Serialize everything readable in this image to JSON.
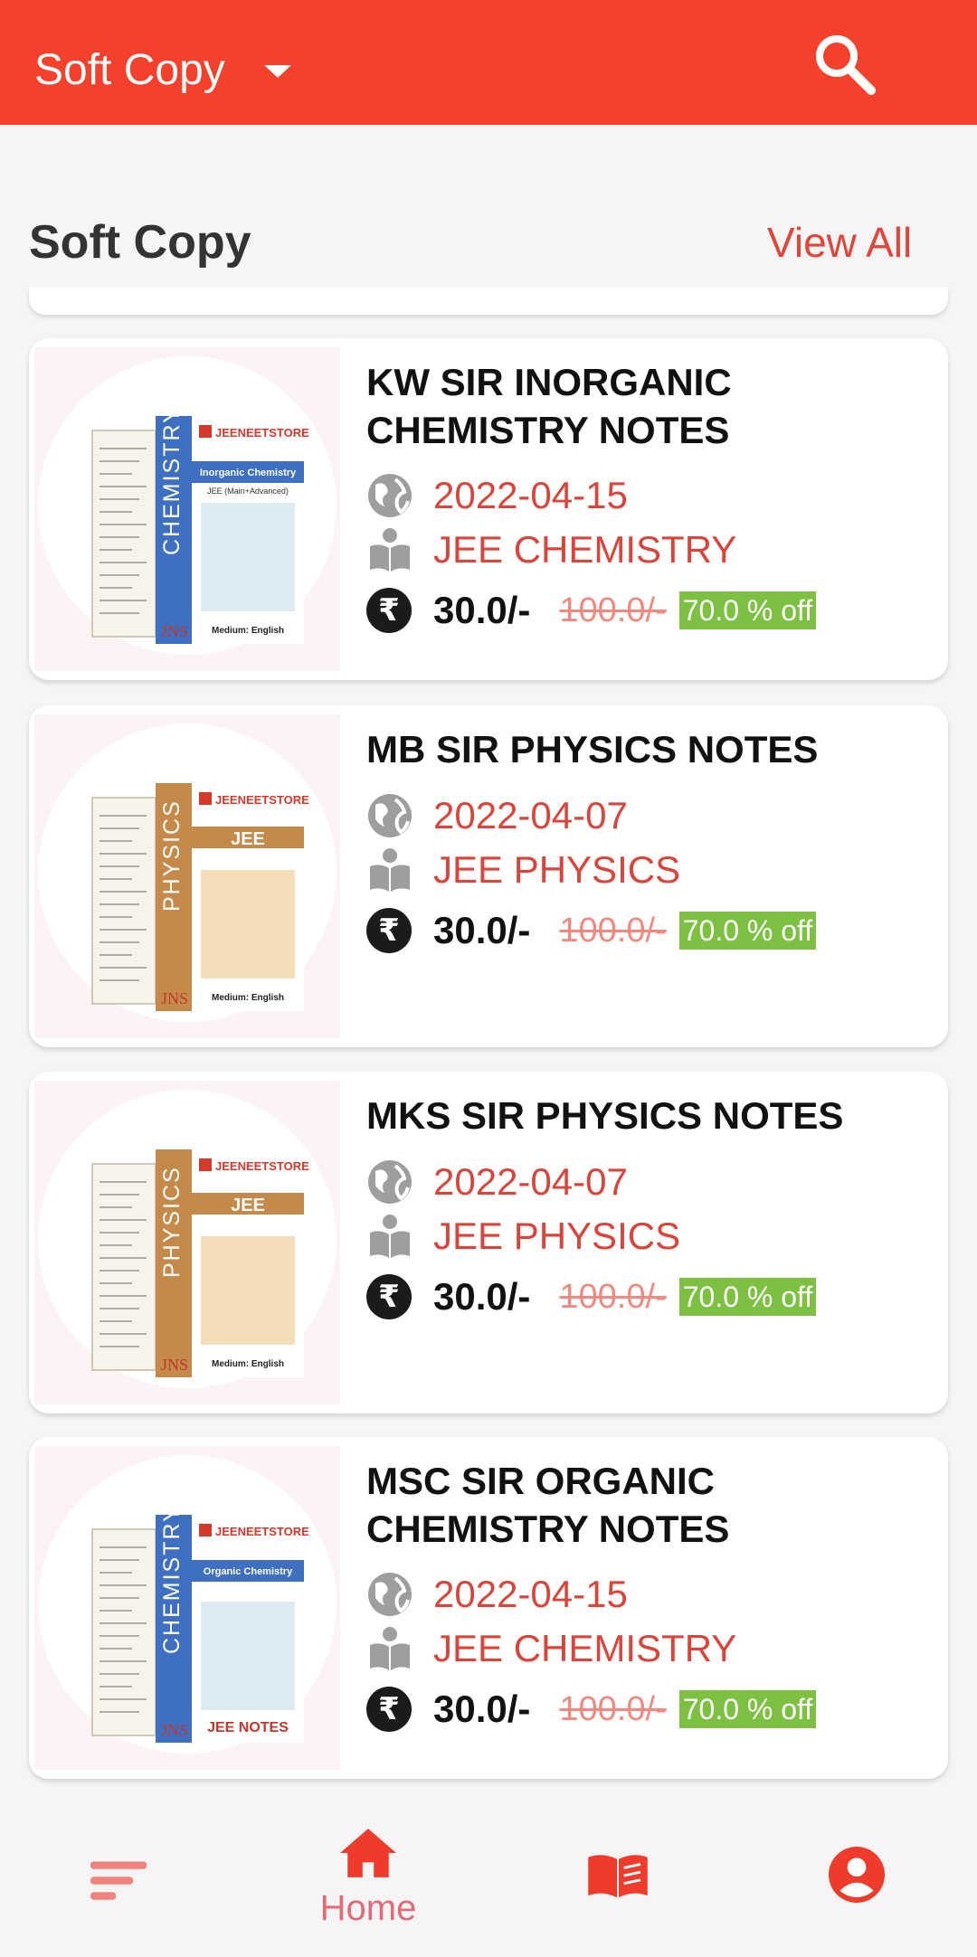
{
  "appbar": {
    "title": "Soft Copy"
  },
  "section": {
    "title": "Soft Copy",
    "view_all": "View All"
  },
  "colors": {
    "primary": "#f5412b",
    "accent_text": "#d9453a",
    "badge": "#7cc142"
  },
  "products": [
    {
      "title": "KW SIR INORGANIC CHEMISTRY NOTES",
      "date": "2022-04-15",
      "category": "JEE CHEMISTRY",
      "price": "30.0/-",
      "old_price": "100.0/-",
      "discount": "70.0 % off",
      "cover": {
        "subject": "CHEMISTRY",
        "brand": "JEENEETSTORE",
        "subtitle": "Inorganic Chemistry",
        "tag": "JEE (Main+Advanced)",
        "medium": "Medium: English",
        "logo": "JNS",
        "spine_color": "#3f6fc0"
      }
    },
    {
      "title": "MB SIR PHYSICS NOTES",
      "date": "2022-04-07",
      "category": "JEE PHYSICS",
      "price": "30.0/-",
      "old_price": "100.0/-",
      "discount": "70.0 % off",
      "cover": {
        "subject": "PHYSICS",
        "brand": "JEENEETSTORE",
        "subtitle": "JEE",
        "tag": "",
        "medium": "Medium: English",
        "logo": "JNS",
        "spine_color": "#c58a4a"
      }
    },
    {
      "title": "MKS SIR PHYSICS NOTES",
      "date": "2022-04-07",
      "category": "JEE PHYSICS",
      "price": "30.0/-",
      "old_price": "100.0/-",
      "discount": "70.0 % off",
      "cover": {
        "subject": "PHYSICS",
        "brand": "JEENEETSTORE",
        "subtitle": "JEE",
        "tag": "",
        "medium": "Medium: English",
        "logo": "JNS",
        "spine_color": "#c58a4a"
      }
    },
    {
      "title": "MSC SIR ORGANIC CHEMISTRY NOTES",
      "date": "2022-04-15",
      "category": "JEE CHEMISTRY",
      "price": "30.0/-",
      "old_price": "100.0/-",
      "discount": "70.0 % off",
      "cover": {
        "subject": "CHEMISTRY",
        "brand": "JEENEETSTORE",
        "subtitle": "Organic Chemistry",
        "tag": "",
        "medium": "JEE NOTES",
        "logo": "JNS",
        "spine_color": "#3f6fc0"
      }
    }
  ],
  "bottom_nav": {
    "items": [
      {
        "icon": "filter-icon",
        "label": ""
      },
      {
        "icon": "home-icon",
        "label": "Home"
      },
      {
        "icon": "book-icon",
        "label": ""
      },
      {
        "icon": "account-icon",
        "label": ""
      }
    ]
  }
}
